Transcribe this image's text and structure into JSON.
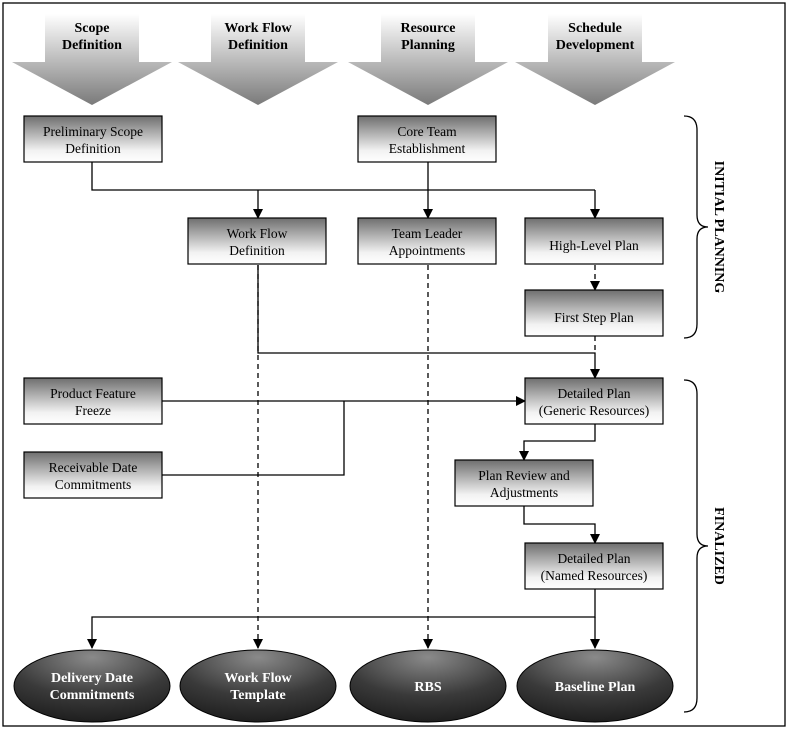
{
  "phases": [
    {
      "line1": "Scope",
      "line2": "Definition"
    },
    {
      "line1": "Work Flow",
      "line2": "Definition"
    },
    {
      "line1": "Resource",
      "line2": "Planning"
    },
    {
      "line1": "Schedule",
      "line2": "Development"
    }
  ],
  "boxes": {
    "prelim_scope": [
      "Preliminary Scope",
      "Definition"
    ],
    "core_team": [
      "Core Team",
      "Establishment"
    ],
    "work_flow_def": [
      "Work Flow",
      "Definition"
    ],
    "team_leader": [
      "Team Leader",
      "Appointments"
    ],
    "high_level": [
      "High-Level Plan"
    ],
    "first_step": [
      "First Step Plan"
    ],
    "product_feature": [
      "Product Feature",
      "Freeze"
    ],
    "receivable": [
      "Receivable Date",
      "Commitments"
    ],
    "detailed_generic": [
      "Detailed Plan",
      "(Generic Resources)"
    ],
    "plan_review": [
      "Plan Review and",
      "Adjustments"
    ],
    "detailed_named": [
      "Detailed Plan",
      "(Named Resources)"
    ]
  },
  "outputs": [
    [
      "Delivery Date",
      "Commitments"
    ],
    [
      "Work Flow",
      "Template"
    ],
    [
      "RBS"
    ],
    [
      "Baseline Plan"
    ]
  ],
  "stages": {
    "initial": "INITIAL PLANNING",
    "finalized": "FINALIZED"
  },
  "colors": {
    "box_top": "#6e6e6e",
    "box_bottom": "#ffffff",
    "ellipse_dark": "#1e1e1e",
    "ellipse_light": "#8a8a8a"
  }
}
